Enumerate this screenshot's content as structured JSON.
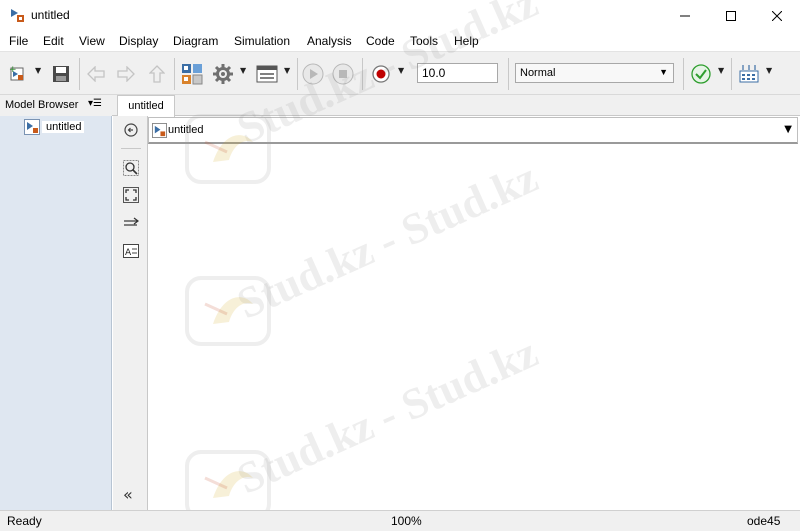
{
  "window": {
    "title": "untitled",
    "controls": {
      "minimize": "—",
      "maximize": "☐",
      "close": "✕"
    },
    "app_icon": "simulink-model-icon"
  },
  "menu": [
    {
      "label": "File"
    },
    {
      "label": "Edit"
    },
    {
      "label": "View"
    },
    {
      "label": "Display"
    },
    {
      "label": "Diagram"
    },
    {
      "label": "Simulation"
    },
    {
      "label": "Analysis"
    },
    {
      "label": "Code"
    },
    {
      "label": "Tools"
    },
    {
      "label": "Help"
    }
  ],
  "toolbar": {
    "icons": [
      "new-model-icon",
      "save-icon",
      "back-icon",
      "forward-icon",
      "up-icon",
      "library-browser-icon",
      "model-settings-gear-icon",
      "model-explorer-icon",
      "run-icon",
      "stop-icon",
      "record-icon",
      "check-icon",
      "build-icon"
    ],
    "stop_time": "10.0",
    "sim_mode": "Normal"
  },
  "model_browser": {
    "label": "Model Browser",
    "items": [
      {
        "label": "untitled"
      }
    ]
  },
  "tabs": [
    {
      "label": "untitled"
    }
  ],
  "address_bar": {
    "path": "untitled"
  },
  "watermark": {
    "text": "Stud.kz - Stud.kz"
  },
  "status": {
    "state": "Ready",
    "zoom": "100%",
    "solver": "ode45"
  },
  "colors": {
    "tree_background": "#dfe7f1",
    "chrome_background": "#f0f0f0",
    "record_red": "#c00000",
    "check_green": "#2e9e2e"
  }
}
